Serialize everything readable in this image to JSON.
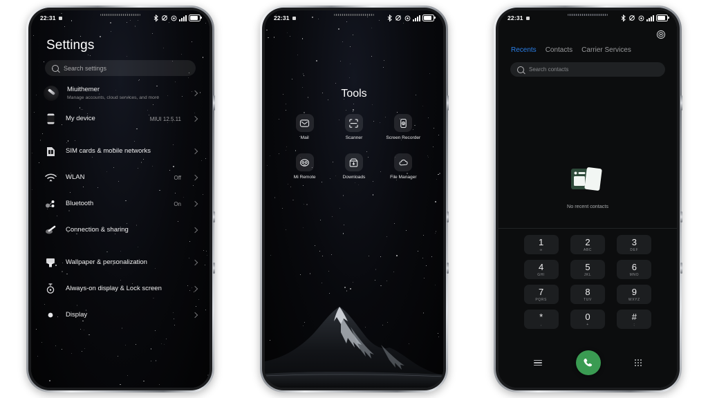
{
  "meta": {
    "background": "#ffffff",
    "accent_blue": "#2a7fe8",
    "call_green": "#3a9b52"
  },
  "status_bar": {
    "time": "22:31",
    "icons": [
      "bluetooth-icon",
      "mute-icon",
      "location-icon",
      "signal-bars-icon",
      "battery-icon"
    ]
  },
  "phone1": {
    "title": "Settings",
    "search": {
      "placeholder": "Search settings",
      "icon": "search-icon"
    },
    "items": [
      {
        "label": "Miuithemer",
        "sub": "Manage accounts, cloud services, and more",
        "value": "",
        "icon": "account-avatar"
      },
      {
        "label": "My device",
        "sub": "",
        "value": "MIUI 12.5.11",
        "icon": "phone-icon"
      },
      {
        "label": "SIM cards & mobile networks",
        "sub": "",
        "value": "",
        "icon": "sim-card-icon"
      },
      {
        "label": "WLAN",
        "sub": "",
        "value": "Off",
        "icon": "wifi-icon"
      },
      {
        "label": "Bluetooth",
        "sub": "",
        "value": "On",
        "icon": "bluetooth-icon"
      },
      {
        "label": "Connection & sharing",
        "sub": "",
        "value": "",
        "icon": "share-icon"
      },
      {
        "label": "Wallpaper & personalization",
        "sub": "",
        "value": "",
        "icon": "brush-icon"
      },
      {
        "label": "Always-on display & Lock screen",
        "sub": "",
        "value": "",
        "icon": "lock-clock-icon"
      },
      {
        "label": "Display",
        "sub": "",
        "value": "",
        "icon": "brightness-icon"
      }
    ]
  },
  "phone2": {
    "folder_title": "Tools",
    "apps": [
      {
        "label": "Mail",
        "icon": "mail-icon"
      },
      {
        "label": "Scanner",
        "icon": "scanner-icon"
      },
      {
        "label": "Screen Recorder",
        "icon": "screen-recorder-icon"
      },
      {
        "label": "Mi Remote",
        "icon": "mi-remote-icon"
      },
      {
        "label": "Downloads",
        "icon": "downloads-icon"
      },
      {
        "label": "File Manager",
        "icon": "cloud-icon"
      }
    ]
  },
  "phone3": {
    "settings_icon": "gear-icon",
    "tabs": [
      {
        "label": "Recents",
        "active": true
      },
      {
        "label": "Contacts",
        "active": false
      },
      {
        "label": "Carrier Services",
        "active": false
      }
    ],
    "search": {
      "placeholder": "Search contacts",
      "icon": "search-icon"
    },
    "empty_state": {
      "text": "No recent contacts",
      "icon": "contact-cards-icon"
    },
    "keypad": [
      {
        "digit": "1",
        "letters": "∞"
      },
      {
        "digit": "2",
        "letters": "ABC"
      },
      {
        "digit": "3",
        "letters": "DEF"
      },
      {
        "digit": "4",
        "letters": "GHI"
      },
      {
        "digit": "5",
        "letters": "JKL"
      },
      {
        "digit": "6",
        "letters": "MNO"
      },
      {
        "digit": "7",
        "letters": "PQRS"
      },
      {
        "digit": "8",
        "letters": "TUV"
      },
      {
        "digit": "9",
        "letters": "WXYZ"
      },
      {
        "digit": "*",
        "letters": ","
      },
      {
        "digit": "0",
        "letters": "+"
      },
      {
        "digit": "#",
        "letters": ";"
      }
    ],
    "dock": [
      {
        "name": "menu-icon"
      },
      {
        "name": "call-button"
      },
      {
        "name": "keypad-icon"
      }
    ]
  }
}
